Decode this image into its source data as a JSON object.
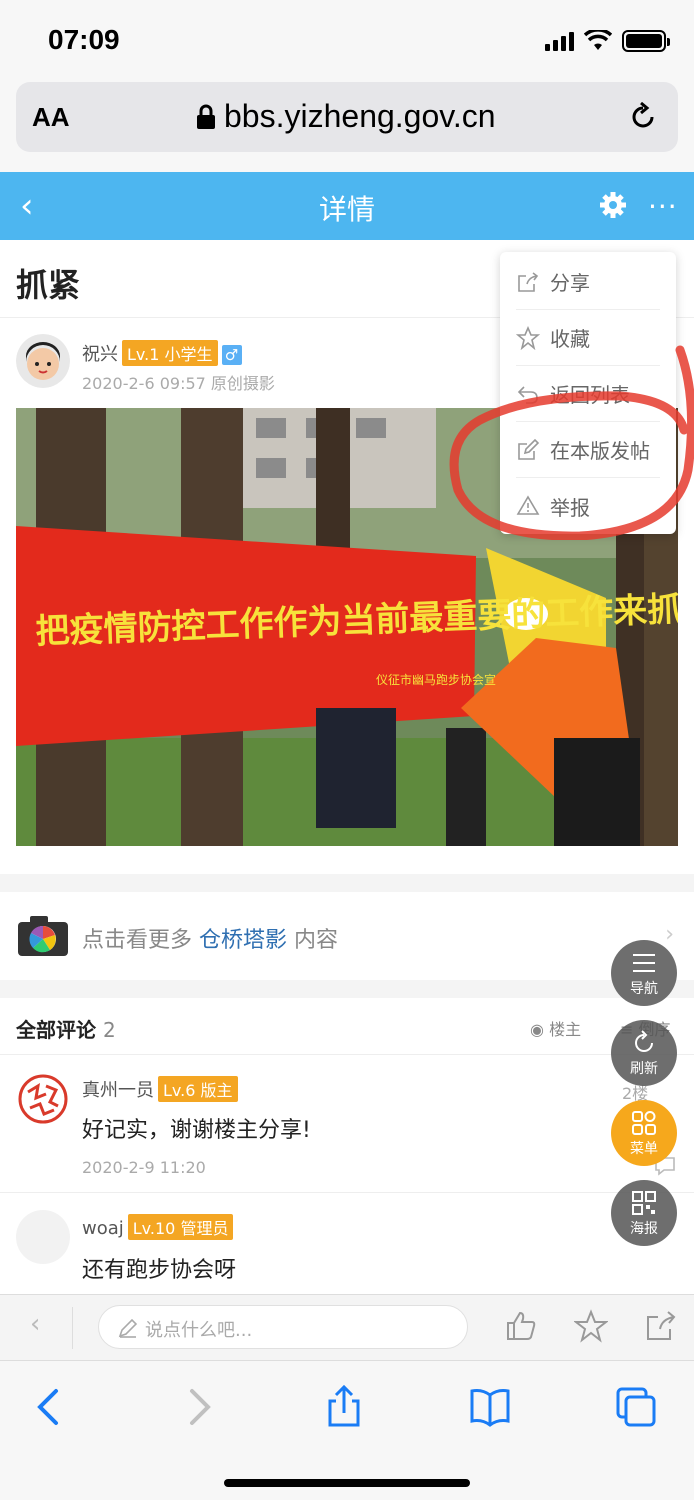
{
  "status_bar": {
    "time": "07:09"
  },
  "address_bar": {
    "text_size": "AA",
    "url": "bbs.yizheng.gov.cn"
  },
  "header": {
    "back": "‹",
    "title": "详情",
    "more": "···"
  },
  "post": {
    "title": "抓紧",
    "author": "祝兴",
    "level": "Lv.1 小学生",
    "gender": "♂",
    "date": "2020-2-6 09:57",
    "category": "原创摄影",
    "banner_text": "把疫情防控工作作为当前最重要的工作来抓",
    "banner_sub": "仪征市幽马跑步协会宣"
  },
  "more_link": {
    "prefix": "点击看更多",
    "link": "仓桥塔影",
    "suffix": "内容"
  },
  "comments": {
    "heading": "全部评论",
    "count": "2",
    "filter_label": "楼主",
    "order_label": "倒序",
    "items": [
      {
        "author": "真州一员",
        "level": "Lv.6 版主",
        "floor": "2楼",
        "text": "好记实，谢谢楼主分享!",
        "date": "2020-2-9 11:20"
      },
      {
        "author": "woaj",
        "level": "Lv.10 管理员",
        "text": "还有跑步协会呀"
      }
    ]
  },
  "toolbar": {
    "placeholder": "说点什么吧..."
  },
  "menu": {
    "items": [
      {
        "label": "分享",
        "icon": "share-icon"
      },
      {
        "label": "收藏",
        "icon": "star-icon"
      },
      {
        "label": "返回列表",
        "icon": "return-icon"
      },
      {
        "label": "在本版发帖",
        "icon": "edit-icon"
      },
      {
        "label": "举报",
        "icon": "warning-icon"
      }
    ]
  },
  "fabs": [
    {
      "label": "导航",
      "icon": "list-icon"
    },
    {
      "label": "刷新",
      "icon": "refresh-icon"
    },
    {
      "label": "菜单",
      "icon": "grid-icon"
    },
    {
      "label": "海报",
      "icon": "qrcode-icon"
    }
  ],
  "colors": {
    "header_bg": "#4db6f0",
    "badge": "#f4a623",
    "annotation": "#e53b2e",
    "fab_orange": "#f6a81c",
    "link": "#2f6fb1"
  }
}
